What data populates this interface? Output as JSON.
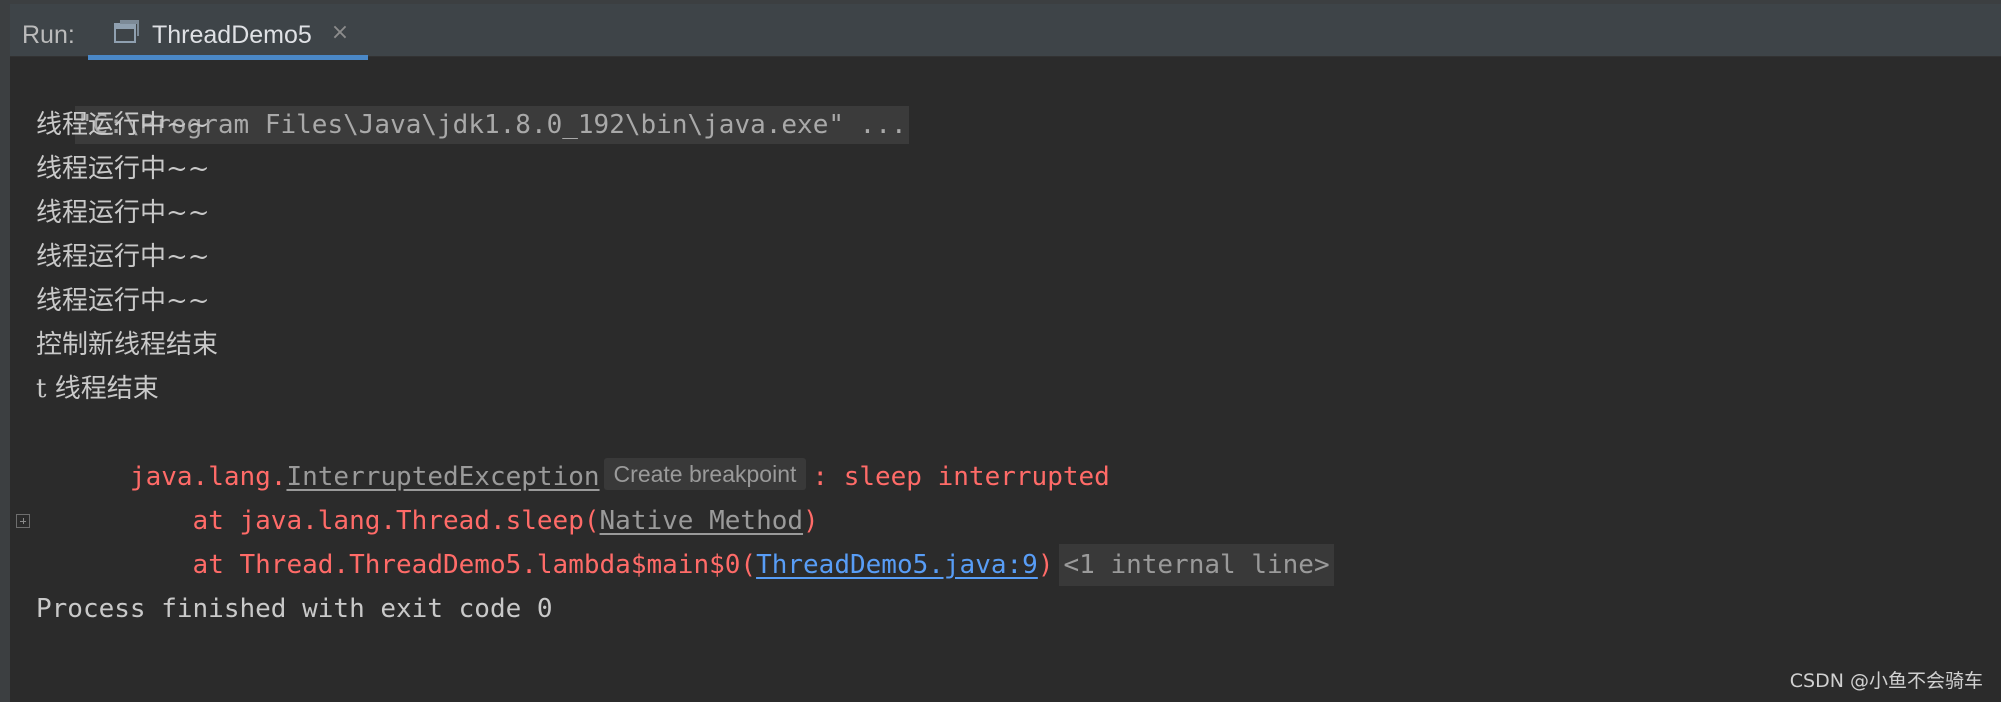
{
  "tool_window": {
    "run_label": "Run:",
    "active_tab": {
      "icon": "run-config-icon",
      "title": "ThreadDemo5",
      "close_glyph": "×"
    }
  },
  "console": {
    "command_line": "\"C:\\Program Files\\Java\\jdk1.8.0_192\\bin\\java.exe\" ...",
    "output_lines": [
      "线程运行中~~",
      "线程运行中~~",
      "线程运行中~~",
      "线程运行中~~",
      "线程运行中~~",
      "控制新线程结束",
      "t 线程结束"
    ],
    "exception": {
      "package_prefix": "java.lang.",
      "class_name": "InterruptedException",
      "breakpoint_chip": "Create breakpoint",
      "message": ": sleep interrupted"
    },
    "stack_trace": [
      {
        "prefix": "    at java.lang.Thread.sleep(",
        "link": "Native Method",
        "suffix": ")",
        "link_style": "grey"
      },
      {
        "prefix": "    at Thread.ThreadDemo5.lambda$main$0(",
        "link": "ThreadDemo5.java:9",
        "suffix": ")",
        "link_style": "blue",
        "folded": "<1 internal line>"
      }
    ],
    "exit_message": "Process finished with exit code 0"
  },
  "watermark": "CSDN @小鱼不会骑车",
  "colors": {
    "background": "#2b2b2b",
    "header": "#3e4448",
    "tab_underline": "#4a88c7",
    "error": "#ff6b68",
    "link": "#589df6",
    "text": "#c9c9c9"
  }
}
